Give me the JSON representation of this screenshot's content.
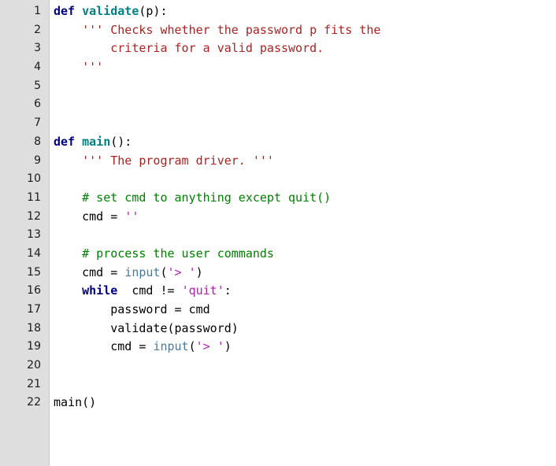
{
  "editor": {
    "language": "python",
    "gutter_background": "#dedede",
    "background": "#ffffff",
    "first_line_number": 1,
    "last_line_number": 22,
    "line_numbers": [
      "1",
      "2",
      "3",
      "4",
      "5",
      "6",
      "7",
      "8",
      "9",
      "10",
      "11",
      "12",
      "13",
      "14",
      "15",
      "16",
      "17",
      "18",
      "19",
      "20",
      "21",
      "22"
    ],
    "colors": {
      "keyword": "#000080",
      "function_name": "#008080",
      "builtin": "#4a7a9b",
      "string": "#aa22aa",
      "docstring": "#aa2222",
      "comment": "#008000",
      "plain": "#000000",
      "gutter_text": "#1a1a1a"
    },
    "lines": [
      {
        "number": "1",
        "tokens": [
          {
            "t": "def ",
            "c": "kw"
          },
          {
            "t": "validate",
            "c": "def"
          },
          {
            "t": "(p):",
            "c": "plain"
          }
        ]
      },
      {
        "number": "2",
        "tokens": [
          {
            "t": "    ''' Checks whether the password p fits the",
            "c": "doc"
          }
        ]
      },
      {
        "number": "3",
        "tokens": [
          {
            "t": "        criteria for a valid password.",
            "c": "doc"
          }
        ]
      },
      {
        "number": "4",
        "tokens": [
          {
            "t": "    '''",
            "c": "doc"
          }
        ]
      },
      {
        "number": "5",
        "tokens": [
          {
            "t": "",
            "c": "plain"
          }
        ]
      },
      {
        "number": "6",
        "tokens": [
          {
            "t": "",
            "c": "plain"
          }
        ]
      },
      {
        "number": "7",
        "tokens": [
          {
            "t": "",
            "c": "plain"
          }
        ]
      },
      {
        "number": "8",
        "tokens": [
          {
            "t": "def ",
            "c": "kw"
          },
          {
            "t": "main",
            "c": "def"
          },
          {
            "t": "():",
            "c": "plain"
          }
        ]
      },
      {
        "number": "9",
        "tokens": [
          {
            "t": "    ''' The program driver. '''",
            "c": "doc"
          }
        ]
      },
      {
        "number": "10",
        "tokens": [
          {
            "t": "",
            "c": "plain"
          }
        ]
      },
      {
        "number": "11",
        "tokens": [
          {
            "t": "    # set cmd to anything except quit()",
            "c": "comment"
          }
        ]
      },
      {
        "number": "12",
        "tokens": [
          {
            "t": "    cmd = ",
            "c": "plain"
          },
          {
            "t": "''",
            "c": "str"
          }
        ]
      },
      {
        "number": "13",
        "tokens": [
          {
            "t": "",
            "c": "plain"
          }
        ]
      },
      {
        "number": "14",
        "tokens": [
          {
            "t": "    # process the user commands",
            "c": "comment"
          }
        ]
      },
      {
        "number": "15",
        "tokens": [
          {
            "t": "    cmd = ",
            "c": "plain"
          },
          {
            "t": "input",
            "c": "builtin"
          },
          {
            "t": "(",
            "c": "plain"
          },
          {
            "t": "'> '",
            "c": "str"
          },
          {
            "t": ")",
            "c": "plain"
          }
        ]
      },
      {
        "number": "16",
        "tokens": [
          {
            "t": "    while",
            "c": "kw"
          },
          {
            "t": "  cmd != ",
            "c": "plain"
          },
          {
            "t": "'quit'",
            "c": "str"
          },
          {
            "t": ":",
            "c": "plain"
          }
        ]
      },
      {
        "number": "17",
        "tokens": [
          {
            "t": "        password = cmd",
            "c": "plain"
          }
        ]
      },
      {
        "number": "18",
        "tokens": [
          {
            "t": "        validate(password)",
            "c": "plain"
          }
        ]
      },
      {
        "number": "19",
        "tokens": [
          {
            "t": "        cmd = ",
            "c": "plain"
          },
          {
            "t": "input",
            "c": "builtin"
          },
          {
            "t": "(",
            "c": "plain"
          },
          {
            "t": "'> '",
            "c": "str"
          },
          {
            "t": ")",
            "c": "plain"
          }
        ]
      },
      {
        "number": "20",
        "tokens": [
          {
            "t": "",
            "c": "plain"
          }
        ]
      },
      {
        "number": "21",
        "tokens": [
          {
            "t": "",
            "c": "plain"
          }
        ]
      },
      {
        "number": "22",
        "tokens": [
          {
            "t": "main()",
            "c": "plain"
          }
        ]
      }
    ]
  }
}
